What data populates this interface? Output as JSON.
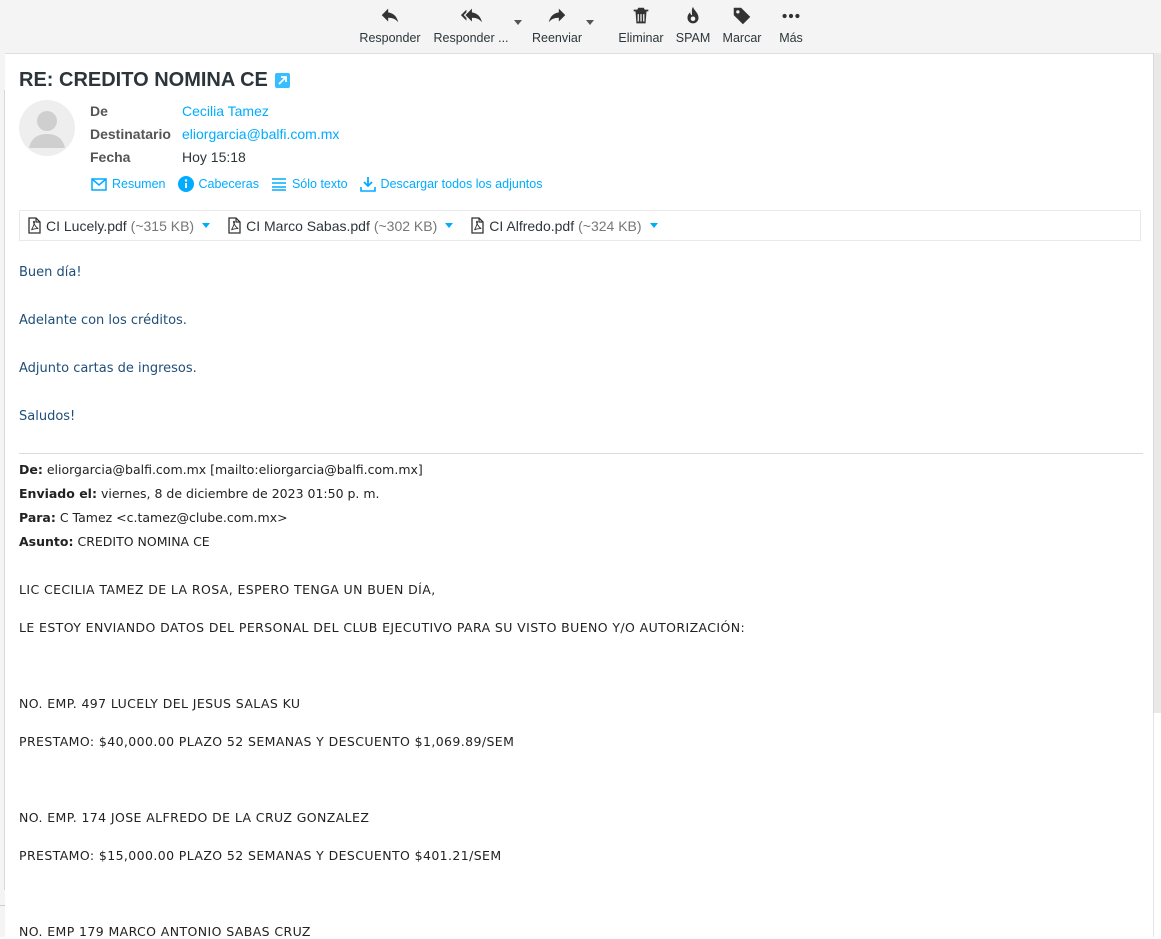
{
  "toolbar": {
    "reply": "Responder",
    "reply_all": "Responder ...",
    "forward": "Reenviar",
    "delete": "Eliminar",
    "spam": "SPAM",
    "mark": "Marcar",
    "more": "Más"
  },
  "message": {
    "subject": "RE: CREDITO NOMINA CE",
    "from_label": "De",
    "from_value": "Cecilia Tamez",
    "to_label": "Destinatario",
    "to_value": "eliorgarcia@balfi.com.mx",
    "date_label": "Fecha",
    "date_value": "Hoy 15:18"
  },
  "header_actions": {
    "summary": "Resumen",
    "headers": "Cabeceras",
    "plain_text": "Sólo texto",
    "download_all": "Descargar todos los adjuntos"
  },
  "attachments": [
    {
      "name": "CI Lucely.pdf",
      "size": "(~315 KB)"
    },
    {
      "name": "CI Marco Sabas.pdf",
      "size": "(~302 KB)"
    },
    {
      "name": "CI Alfredo.pdf",
      "size": "(~324 KB)"
    }
  ],
  "body": {
    "greeting": "Buen día!",
    "line1": "Adelante con los créditos.",
    "line2": "Adjunto cartas de ingresos.",
    "closing": "Saludos!"
  },
  "quoted": {
    "from_label": "De:",
    "from_value": "eliorgarcia@balfi.com.mx [mailto:eliorgarcia@balfi.com.mx]",
    "sent_label": "Enviado el:",
    "sent_value": "viernes, 8 de diciembre de 2023 01:50 p. m.",
    "to_label": "Para:",
    "to_value": "C Tamez <c.tamez@clube.com.mx>",
    "subject_label": "Asunto:",
    "subject_value": "CREDITO NOMINA CE",
    "p1": "LIC CECILIA TAMEZ DE LA ROSA, ESPERO TENGA UN BUEN DÍA,",
    "p2": "LE ESTOY ENVIANDO DATOS DEL PERSONAL DEL CLUB EJECUTIVO PARA SU VISTO BUENO Y/O AUTORIZACIÓN:",
    "emp1": "NO. EMP. 497 LUCELY DEL JESUS SALAS KU",
    "loan1": "PRESTAMO: $40,000.00 PLAZO 52 SEMANAS Y DESCUENTO $1,069.89/SEM",
    "emp2": "NO. EMP. 174 JOSE ALFREDO DE LA CRUZ GONZALEZ",
    "loan2": "PRESTAMO: $15,000.00 PLAZO 52 SEMANAS Y DESCUENTO $401.21/SEM",
    "emp3": "NO. EMP 179 MARCO ANTONIO SABAS CRUZ"
  },
  "colors": {
    "accent": "#00acff",
    "body_text": "#1f4e79",
    "toolbar_bg": "#f4f4f4"
  }
}
